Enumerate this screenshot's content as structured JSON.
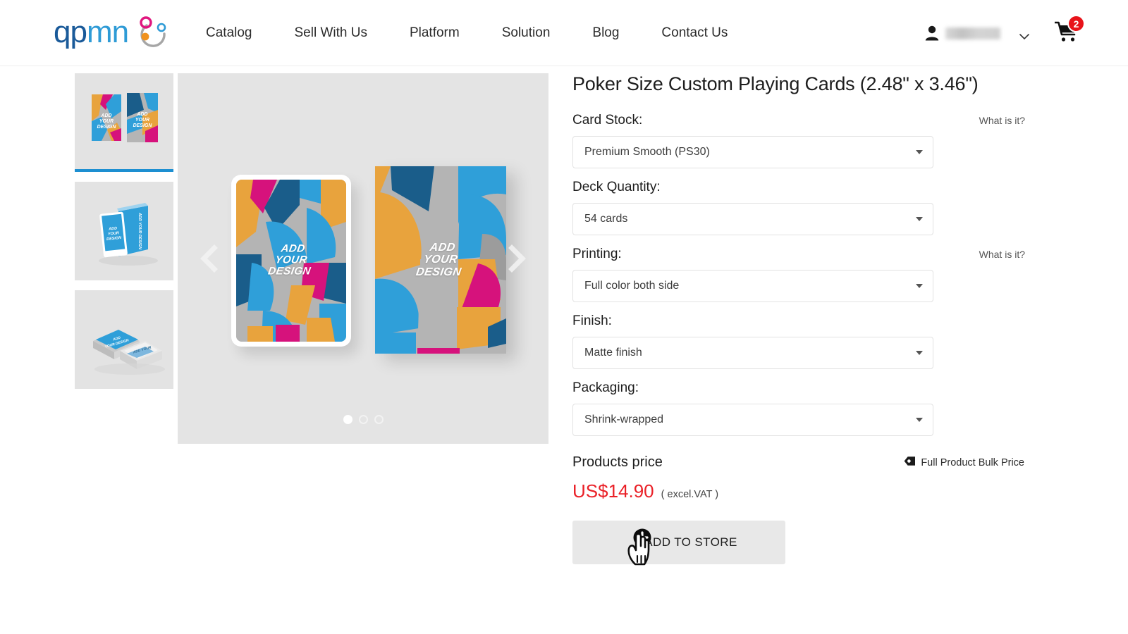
{
  "header": {
    "logo": {
      "part1": "qp",
      "part2": "mn",
      "mark_icon": "circle-orbit-logo-icon"
    },
    "nav": [
      {
        "label": "Catalog"
      },
      {
        "label": "Sell With Us"
      },
      {
        "label": "Platform"
      },
      {
        "label": "Solution"
      },
      {
        "label": "Blog"
      },
      {
        "label": "Contact Us"
      }
    ],
    "account": {
      "user_icon": "user-icon",
      "user_name": "",
      "chevron_icon": "chevron-down-icon"
    },
    "cart": {
      "icon": "shopping-cart-icon",
      "badge_count": "2"
    }
  },
  "gallery": {
    "thumbnails": [
      {
        "alt": "Two playing cards front and back",
        "active": true
      },
      {
        "alt": "Blue card deck box standing",
        "active": false
      },
      {
        "alt": "Stacked blue card decks",
        "active": false
      }
    ],
    "main_image": {
      "card_text_line1": "ADD",
      "card_text_line2": "YOUR",
      "card_text_line3": "DESIGN"
    },
    "prev_icon": "chevron-left-icon",
    "next_icon": "chevron-right-icon",
    "dots": [
      {
        "active": true
      },
      {
        "active": false
      },
      {
        "active": false
      }
    ]
  },
  "product": {
    "title": "Poker Size Custom Playing Cards (2.48\" x 3.46\")",
    "what_is_it_label": "What is it?",
    "options": [
      {
        "label": "Card Stock:",
        "value": "Premium Smooth (PS30)",
        "has_help": true
      },
      {
        "label": "Deck Quantity:",
        "value": "54 cards",
        "has_help": false
      },
      {
        "label": "Printing:",
        "value": "Full color both side",
        "has_help": true
      },
      {
        "label": "Finish:",
        "value": "Matte finish",
        "has_help": false
      },
      {
        "label": "Packaging:",
        "value": "Shrink-wrapped",
        "has_help": false
      }
    ],
    "price": {
      "heading": "Products price",
      "bulk_link_label": "Full Product Bulk Price",
      "bulk_link_icon": "tag-icon",
      "amount": "US$14.90",
      "vat_note": "( excel.VAT )"
    },
    "add_to_store_label": "ADD TO STORE",
    "add_to_store_icon": "plus-circle-icon",
    "cursor_icon": "pointing-hand-cursor-icon"
  },
  "colors": {
    "logo_dark_blue": "#1a5a99",
    "logo_light_blue": "#2e9bd6",
    "logo_magenta": "#e0177f",
    "logo_orange": "#f0921e",
    "accent_blue": "#1d8fd1",
    "price_red": "#ea2027",
    "badge_red": "#e8131a",
    "art_orange": "#e8a33d",
    "art_magenta": "#d6127c",
    "art_dark_blue": "#1a5d8a",
    "art_light_blue": "#2f9fd9",
    "art_gray": "#b4b4b4"
  }
}
